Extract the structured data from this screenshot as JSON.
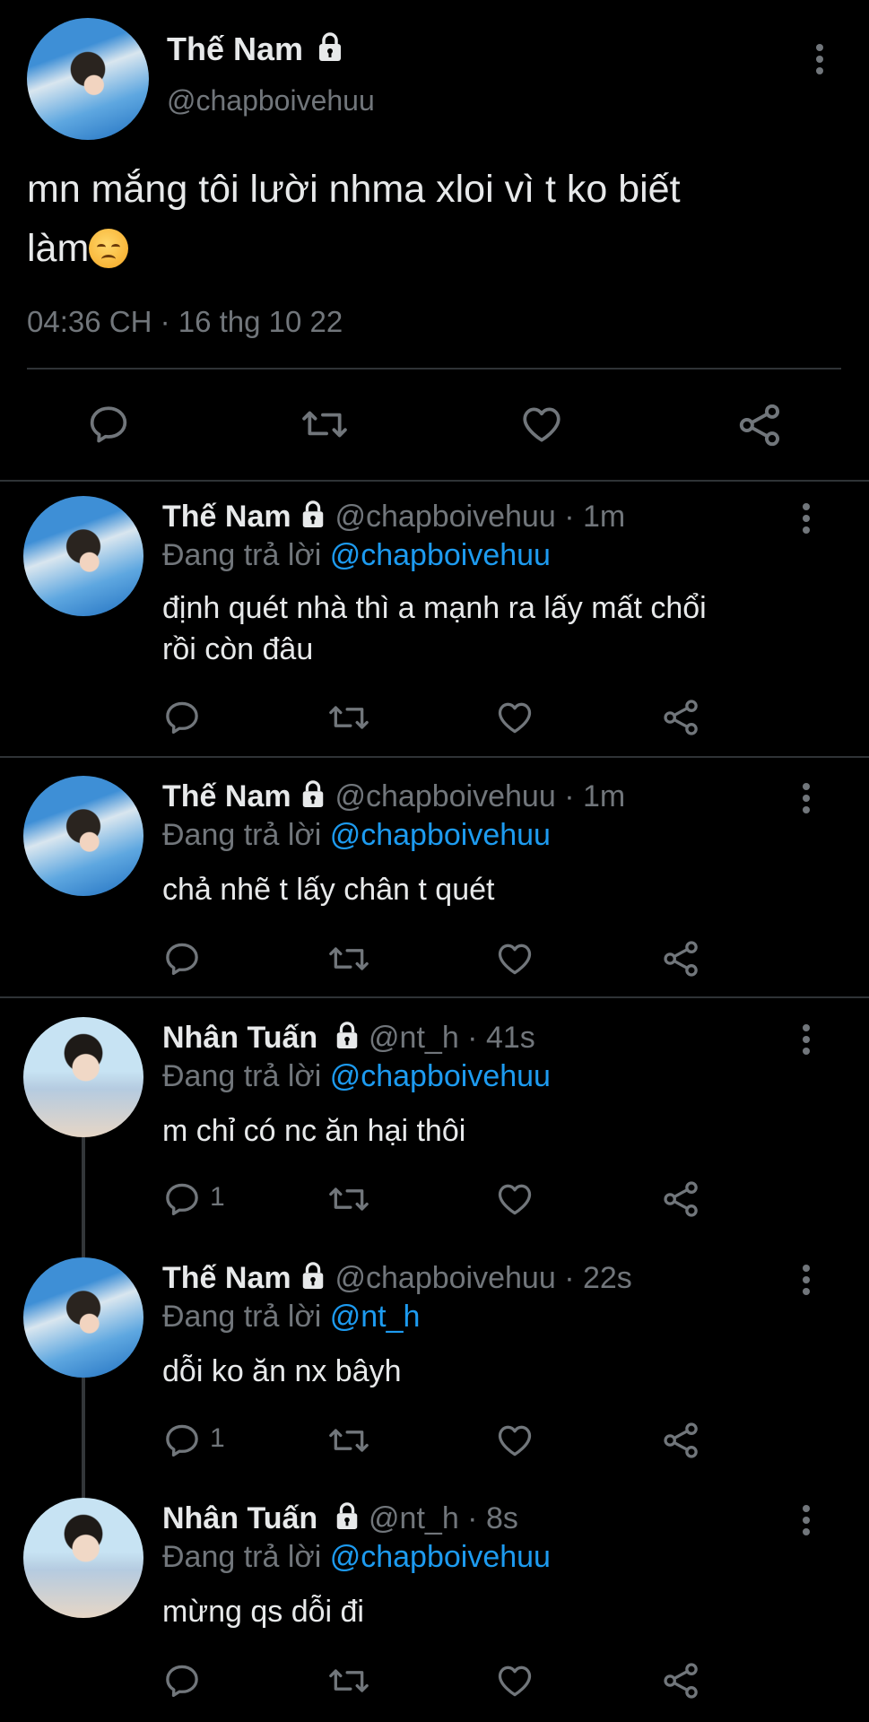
{
  "main_tweet": {
    "name": "Thế Nam",
    "handle": "@chapboivehuu",
    "text_line1": "mn mắng tôi lười nhma xloi vì t ko biết",
    "text_line2": "làm",
    "emoji": "disappointed-face",
    "timestamp": "04:36 CH · 16 thg 10 22"
  },
  "replies": [
    {
      "name": "Thế Nam",
      "meta": "@chapboivehuu · 1m",
      "reply_prefix": "Đang trả lời",
      "reply_to": "@chapboivehuu",
      "line1": "định quét nhà thì a mạnh ra lấy mất chổi",
      "line2": "rồi còn đâu",
      "reply_count": ""
    },
    {
      "name": "Thế Nam",
      "meta": "@chapboivehuu · 1m",
      "reply_prefix": "Đang trả lời",
      "reply_to": "@chapboivehuu",
      "line1": "chả nhẽ t lấy chân t quét",
      "reply_count": ""
    },
    {
      "name": "Nhân Tuấn",
      "meta": "@nt_h · 41s",
      "reply_prefix": "Đang trả lời",
      "reply_to": "@chapboivehuu",
      "line1": "m chỉ có nc ăn hại thôi",
      "reply_count": "1"
    },
    {
      "name": "Thế Nam",
      "meta": "@chapboivehuu · 22s",
      "reply_prefix": "Đang trả lời",
      "reply_to": "@nt_h",
      "line1": "dỗi ko ăn nx bâyh",
      "reply_count": "1"
    },
    {
      "name": "Nhân Tuấn",
      "meta": "@nt_h · 8s",
      "reply_prefix": "Đang trả lời",
      "reply_to": "@chapboivehuu",
      "line1": "mừng qs dỗi đi",
      "reply_count": ""
    }
  ],
  "icons": {
    "lock": "lock-icon",
    "more": "more-vertical-icon",
    "reply": "reply-icon",
    "retweet": "retweet-icon",
    "like": "like-icon",
    "share": "share-icon"
  },
  "colors": {
    "background": "#000000",
    "text": "#e7e9ea",
    "muted": "#71767b",
    "link": "#1d9bf0"
  }
}
